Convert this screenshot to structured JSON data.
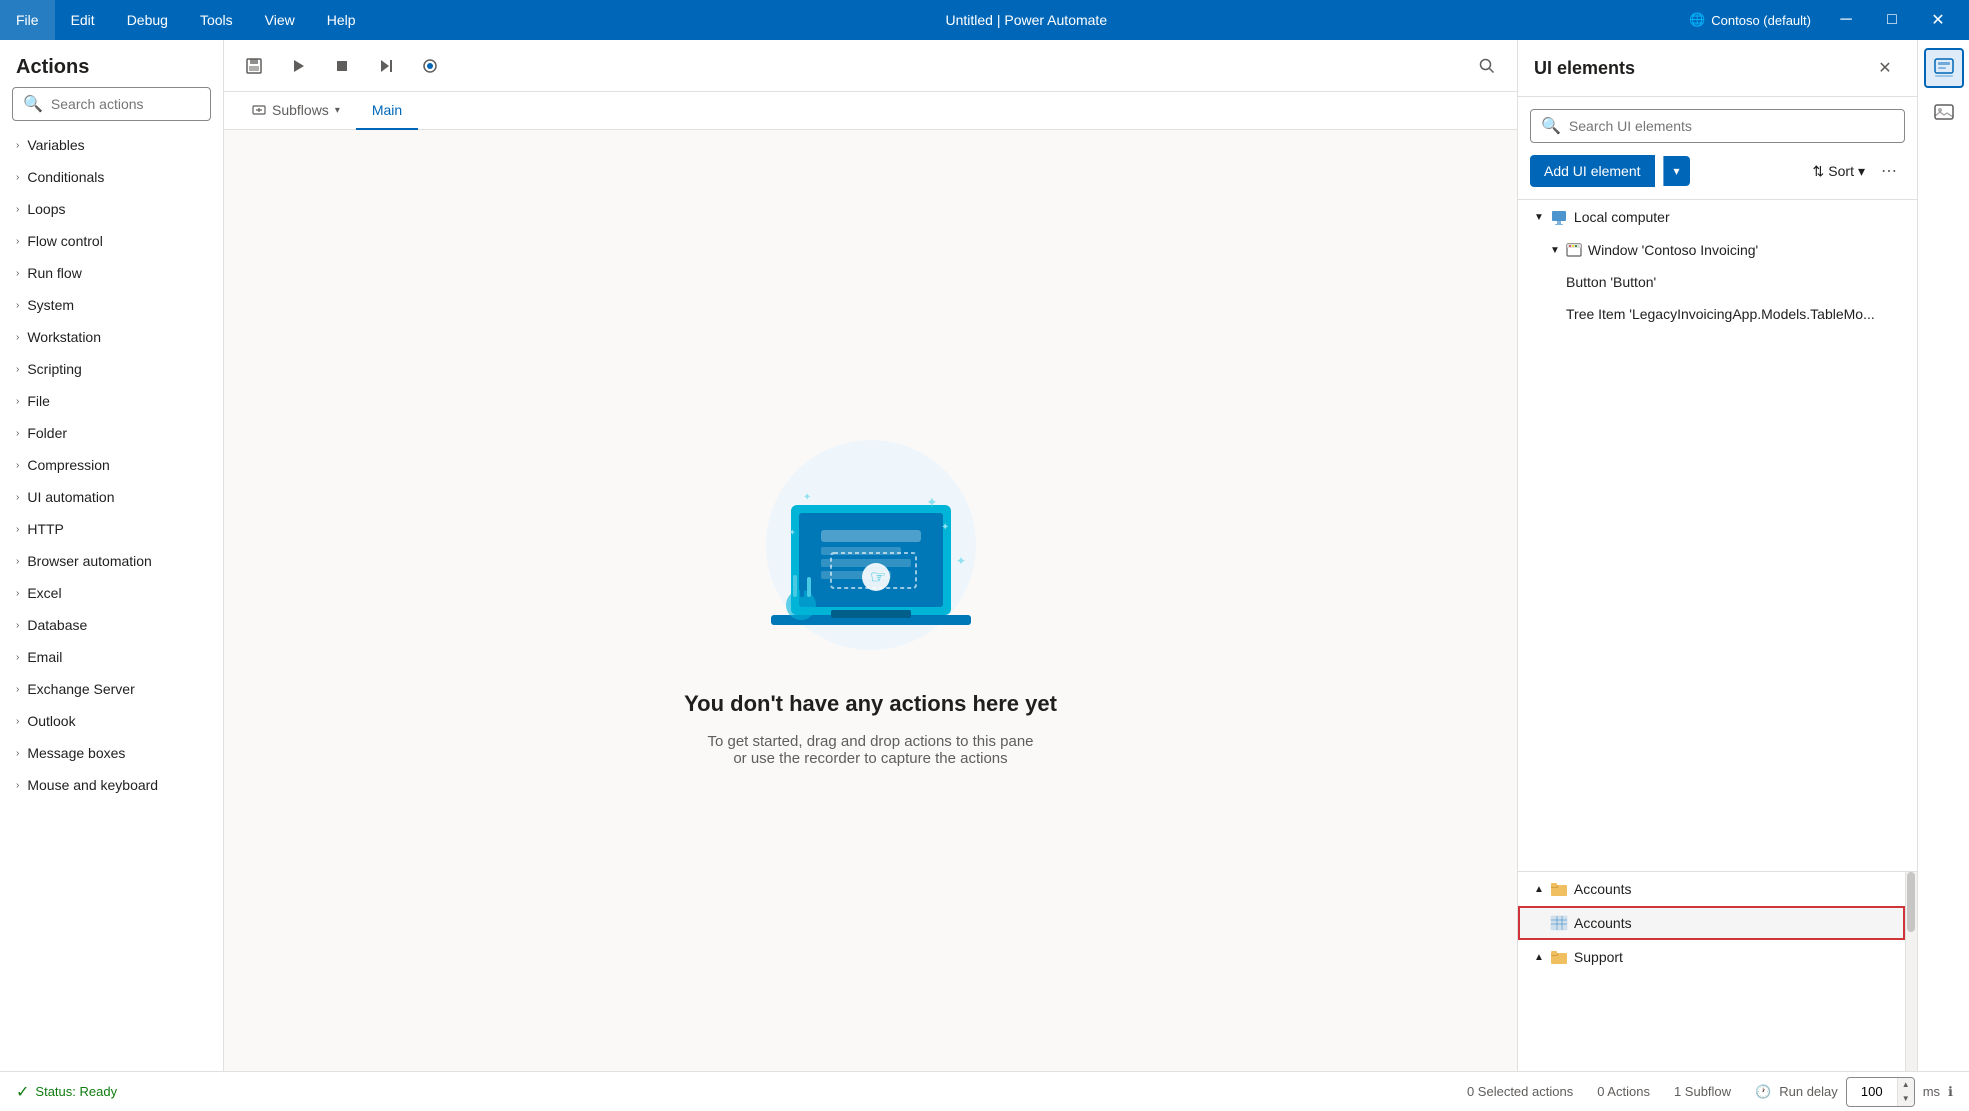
{
  "titlebar": {
    "menu": [
      "File",
      "Edit",
      "Debug",
      "Tools",
      "View",
      "Help"
    ],
    "title": "Untitled | Power Automate",
    "account": "Contoso (default)",
    "controls": [
      "—",
      "⬜",
      "✕"
    ]
  },
  "actions_panel": {
    "title": "Actions",
    "search_placeholder": "Search actions",
    "items": [
      "Variables",
      "Conditionals",
      "Loops",
      "Flow control",
      "Run flow",
      "System",
      "Workstation",
      "Scripting",
      "File",
      "Folder",
      "Compression",
      "UI automation",
      "HTTP",
      "Browser automation",
      "Excel",
      "Database",
      "Email",
      "Exchange Server",
      "Outlook",
      "Message boxes",
      "Mouse and keyboard"
    ]
  },
  "toolbar": {
    "buttons": [
      "💾",
      "▶",
      "⬛",
      "⏭"
    ]
  },
  "tabs": {
    "items": [
      "Subflows",
      "Main"
    ],
    "active": "Main"
  },
  "empty_state": {
    "title": "You don't have any actions here yet",
    "subtitle_line1": "To get started, drag and drop actions to this pane",
    "subtitle_line2": "or use the recorder to capture the actions"
  },
  "ui_panel": {
    "title": "UI elements",
    "search_placeholder": "Search UI elements",
    "add_button_label": "Add UI element",
    "sort_label": "Sort",
    "tree": [
      {
        "label": "Local computer",
        "icon": "computer",
        "level": 0,
        "expanded": true,
        "children": [
          {
            "label": "Window 'Contoso Invoicing'",
            "icon": "window",
            "level": 1,
            "expanded": true,
            "children": [
              {
                "label": "Button 'Button'",
                "icon": null,
                "level": 2
              },
              {
                "label": "Tree Item 'LegacyInvoicingApp.Models.TableMo...",
                "icon": null,
                "level": 2
              }
            ]
          }
        ]
      }
    ],
    "bottom_tree": [
      {
        "label": "Accounts",
        "icon": "folder",
        "level": 0,
        "expanded": true
      },
      {
        "label": "Accounts",
        "icon": "table",
        "level": 1,
        "highlighted": true
      },
      {
        "label": "Support",
        "icon": "folder",
        "level": 0,
        "expanded": true
      }
    ]
  },
  "status_bar": {
    "status_label": "Status: Ready",
    "selected_actions": "0 Selected actions",
    "actions_count": "0 Actions",
    "subflow_count": "1 Subflow",
    "run_delay_label": "Run delay",
    "run_delay_value": "100",
    "run_delay_unit": "ms"
  }
}
